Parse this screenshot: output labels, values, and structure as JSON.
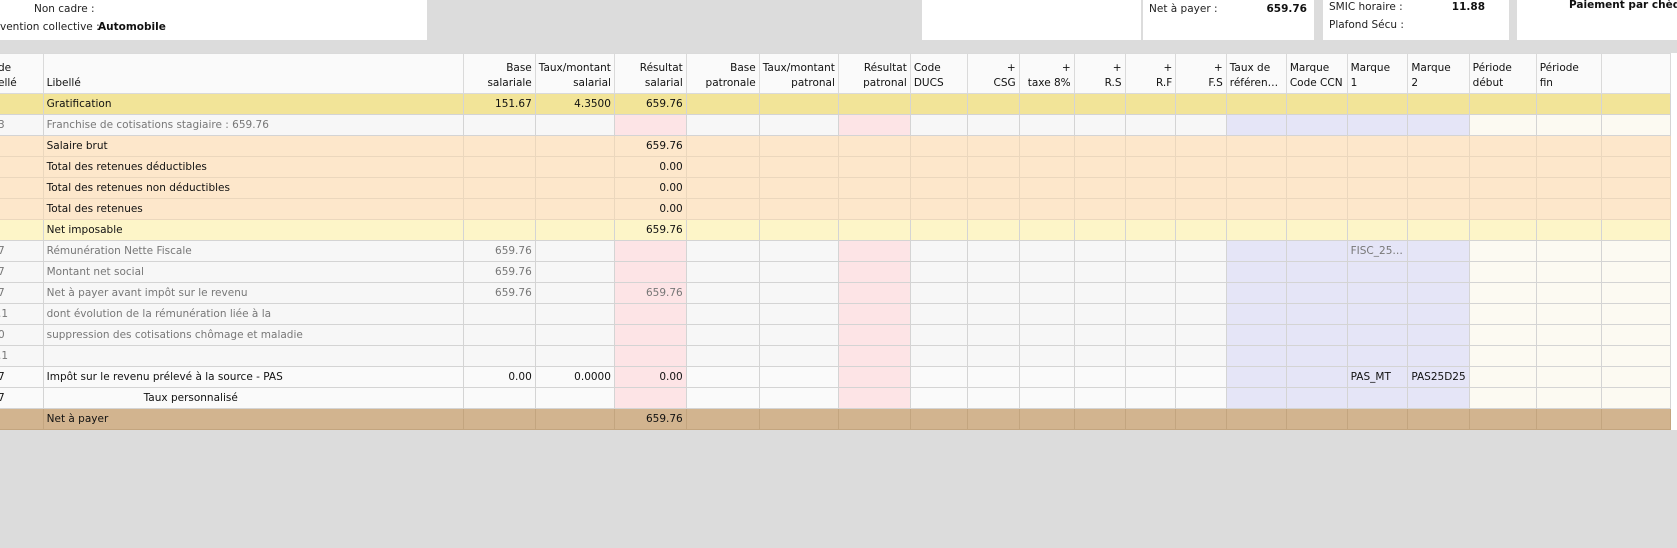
{
  "header": {
    "non_cadre_label": "Non cadre :",
    "convention_label": "vention collective :",
    "convention_value": "Automobile",
    "net_label": "Net à payer :",
    "net_value": "659.76",
    "smic_label": "SMIC horaire :",
    "smic_value": "11.88",
    "plafond_label": "Plafond Sécu :",
    "payment_label": "Paiement par chèqu"
  },
  "columns": [
    {
      "l1": "de",
      "l2": "ellé"
    },
    {
      "l1": "",
      "l2": "Libellé"
    },
    {
      "l1": "Base",
      "l2": "salariale"
    },
    {
      "l1": "Taux/montant",
      "l2": "salarial"
    },
    {
      "l1": "Résultat",
      "l2": "salarial"
    },
    {
      "l1": "Base",
      "l2": "patronale"
    },
    {
      "l1": "Taux/montant",
      "l2": "patronal"
    },
    {
      "l1": "Résultat",
      "l2": "patronal"
    },
    {
      "l1": "Code",
      "l2": "DUCS"
    },
    {
      "l1": "+",
      "l2": "CSG"
    },
    {
      "l1": "+",
      "l2": "taxe 8%"
    },
    {
      "l1": "+",
      "l2": "R.S"
    },
    {
      "l1": "+",
      "l2": "R.F"
    },
    {
      "l1": "+",
      "l2": "F.S"
    },
    {
      "l1": "Taux de",
      "l2": "référen…"
    },
    {
      "l1": "Marque",
      "l2": "Code CCN"
    },
    {
      "l1": "Marque",
      "l2": "1"
    },
    {
      "l1": "Marque",
      "l2": "2"
    },
    {
      "l1": "Période",
      "l2": "début"
    },
    {
      "l1": "Période",
      "l2": "fin"
    },
    {
      "l1": "",
      "l2": ""
    }
  ],
  "rows": [
    {
      "code": "",
      "label": "Gratification",
      "base_sal": "151.67",
      "taux_sal": "4.3500",
      "res_sal": "659.76",
      "marque1": "",
      "marque2": ""
    },
    {
      "code": "3",
      "label": "Franchise de cotisations stagiaire : 659.76",
      "base_sal": "",
      "taux_sal": "",
      "res_sal": "",
      "marque1": "",
      "marque2": ""
    },
    {
      "code": "",
      "label": "Salaire brut",
      "base_sal": "",
      "taux_sal": "",
      "res_sal": "659.76",
      "marque1": "",
      "marque2": ""
    },
    {
      "code": "",
      "label": "Total des retenues déductibles",
      "base_sal": "",
      "taux_sal": "",
      "res_sal": "0.00",
      "marque1": "",
      "marque2": ""
    },
    {
      "code": "",
      "label": "Total des retenues non déductibles",
      "base_sal": "",
      "taux_sal": "",
      "res_sal": "0.00",
      "marque1": "",
      "marque2": ""
    },
    {
      "code": "",
      "label": "Total des retenues",
      "base_sal": "",
      "taux_sal": "",
      "res_sal": "0.00",
      "marque1": "",
      "marque2": ""
    },
    {
      "code": "",
      "label": "Net imposable",
      "base_sal": "",
      "taux_sal": "",
      "res_sal": "659.76",
      "marque1": "",
      "marque2": ""
    },
    {
      "code": "7",
      "label": "Rémunération Nette Fiscale",
      "base_sal": "659.76",
      "taux_sal": "",
      "res_sal": "",
      "marque1": "FISC_25…",
      "marque2": ""
    },
    {
      "code": "7",
      "label": "Montant net social",
      "base_sal": "659.76",
      "taux_sal": "",
      "res_sal": "",
      "marque1": "",
      "marque2": ""
    },
    {
      "code": "7",
      "label": "Net à payer avant impôt sur le revenu",
      "base_sal": "659.76",
      "taux_sal": "",
      "res_sal": "659.76",
      "marque1": "",
      "marque2": ""
    },
    {
      "code": ".1",
      "label": "dont évolution de la rémunération liée à la",
      "base_sal": "",
      "taux_sal": "",
      "res_sal": "",
      "marque1": "",
      "marque2": ""
    },
    {
      "code": "0",
      "label": "suppression des cotisations chômage et maladie",
      "base_sal": "",
      "taux_sal": "",
      "res_sal": "",
      "marque1": "",
      "marque2": ""
    },
    {
      "code": ".1",
      "label": "",
      "base_sal": "",
      "taux_sal": "",
      "res_sal": "",
      "marque1": "",
      "marque2": ""
    },
    {
      "code": "7",
      "label": "Impôt sur le revenu prélevé à la source - PAS",
      "base_sal": "0.00",
      "taux_sal": "0.0000",
      "res_sal": "0.00",
      "marque1": "PAS_MT",
      "marque2": "PAS25D25"
    },
    {
      "code": "7",
      "label": "Taux personnalisé",
      "base_sal": "",
      "taux_sal": "",
      "res_sal": "",
      "marque1": "",
      "marque2": ""
    },
    {
      "code": "",
      "label": "Net à payer",
      "base_sal": "",
      "taux_sal": "",
      "res_sal": "659.76",
      "marque1": "",
      "marque2": ""
    }
  ]
}
